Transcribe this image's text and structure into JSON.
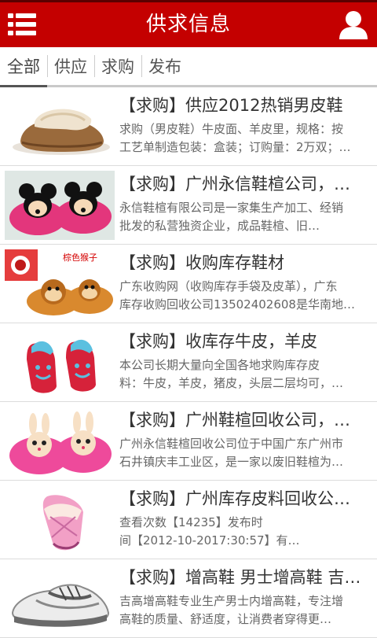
{
  "header": {
    "title": "供求信息",
    "menu_icon": "menu-icon",
    "user_icon": "user-icon",
    "bg_color": "#c40000"
  },
  "tabs": [
    {
      "label": "全部",
      "active": true
    },
    {
      "label": "供应"
    },
    {
      "label": "求购"
    },
    {
      "label": "发布"
    }
  ],
  "items": [
    {
      "title": "【求购】供应2012热销男皮鞋",
      "desc1": "求购（男皮鞋）牛皮面、羊皮里，规格：按",
      "desc2": "工艺单制造包装：盒装；订购量：2万双；…",
      "image": "brown sheepskin slipper"
    },
    {
      "title": "【求购】广州永信鞋楦公司，…",
      "desc1": "永信鞋楦有限公司是一家集生产加工、经销",
      "desc2": "批发的私营独资企业，成品鞋楦、旧…",
      "image": "mickey mouse slippers"
    },
    {
      "title": "【求购】收购库存鞋材",
      "desc1": "广东收购网（收购库存手袋及皮革），广东",
      "desc2": "库存收购回收公司13502402608是华南地…",
      "image": "monkey slippers",
      "badge": "棕色猴子"
    },
    {
      "title": "【求购】收库存牛皮，羊皮",
      "desc1": "本公司长期大量向全国各地求购库存皮",
      "desc2": "料：牛皮，羊皮，猪皮，头层二层均可，…",
      "image": "red smiley slippers"
    },
    {
      "title": "【求购】广州鞋楦回收公司，…",
      "desc1": "广州永信鞋楦回收公司位于中国广东广州市",
      "desc2": "石井镇庆丰工业区，是一家以废旧鞋楦为…",
      "image": "pink bunny slippers"
    },
    {
      "title": "【求购】广州库存皮料回收公…",
      "desc1": "查看次数【14235】发布时",
      "desc2": "间【2012-10-2017:30:57】有…",
      "image": "pink plush slipper"
    },
    {
      "title": "【求购】增高鞋 男士增高鞋 吉…",
      "desc1": "吉高增高鞋专业生产男士内增高鞋，专注增",
      "desc2": "高鞋的质量、舒适度，让消费者穿得更…",
      "image": "white sports shoe"
    }
  ]
}
